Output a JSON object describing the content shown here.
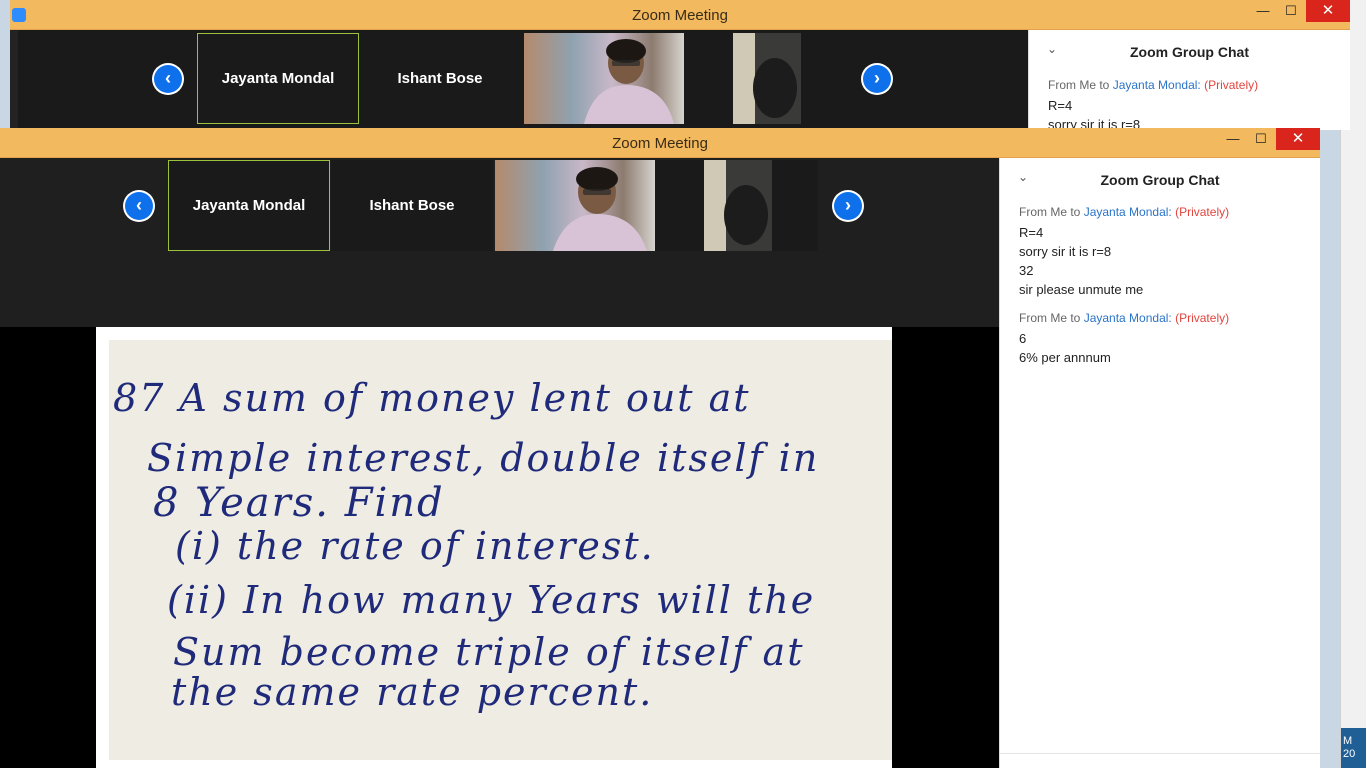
{
  "window_back": {
    "title": "Zoom Meeting",
    "controls": {
      "minimize": "—",
      "maximize": "☐",
      "close": "✕"
    },
    "participants": [
      {
        "name": "Jayanta Mondal"
      },
      {
        "name": "Ishant Bose"
      }
    ],
    "chat": {
      "header": "Zoom Group Chat",
      "groups": [
        {
          "from": "From Me to",
          "to": "Jayanta Mondal:",
          "privacy": "(Privately)",
          "lines": [
            "R=4",
            "sorry sir it is r=8"
          ]
        }
      ]
    }
  },
  "window_front": {
    "title": "Zoom Meeting",
    "controls": {
      "minimize": "—",
      "maximize": "☐",
      "close": "✕"
    },
    "nav": {
      "prev": "‹",
      "next": "›"
    },
    "participants": [
      {
        "name": "Jayanta Mondal"
      },
      {
        "name": "Ishant Bose"
      }
    ],
    "chat": {
      "header": "Zoom Group Chat",
      "groups": [
        {
          "from": "From Me to",
          "to": "Jayanta Mondal:",
          "privacy": "(Privately)",
          "lines": [
            "R=4",
            "sorry sir it is r=8",
            "32",
            "sir please unmute me"
          ]
        },
        {
          "from": "From Me to",
          "to": "Jayanta Mondal:",
          "privacy": "(Privately)",
          "lines": [
            "6",
            "6% per annnum"
          ]
        }
      ]
    }
  },
  "shared_content": {
    "lines": [
      "87  A  sum  of  money  lent  out  at",
      "Simple  interest,  double  itself  in",
      "8 Years.  Find",
      "(i)  the  rate  of  interest.",
      "(ii)  In  how  many  Years  will  the",
      "Sum  become  triple  of  itself  at",
      "the  same  rate  percent."
    ]
  },
  "taskbar": {
    "clock_fragment": "M\n20"
  }
}
